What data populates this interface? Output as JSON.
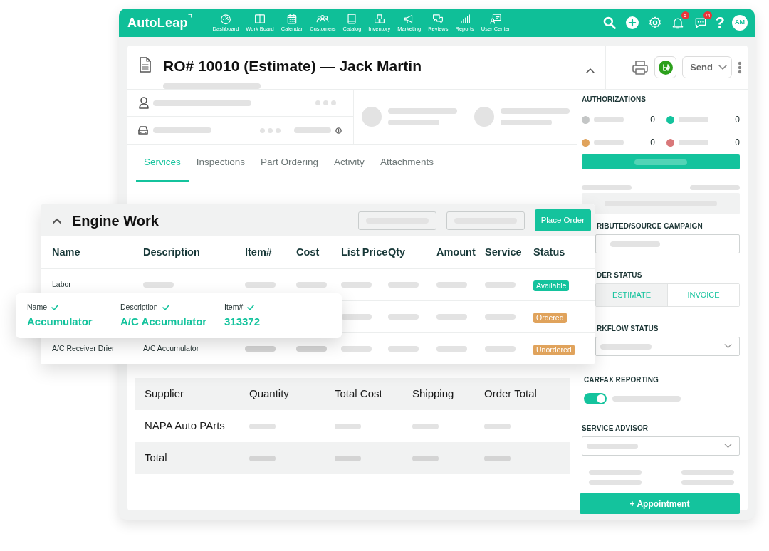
{
  "app": {
    "logo": "AutoLeap"
  },
  "nav": [
    {
      "label": "Dashboard"
    },
    {
      "label": "Work Board"
    },
    {
      "label": "Calendar"
    },
    {
      "label": "Customers"
    },
    {
      "label": "Catalog"
    },
    {
      "label": "Inventory"
    },
    {
      "label": "Marketing"
    },
    {
      "label": "Reviews"
    },
    {
      "label": "Reports"
    },
    {
      "label": "User Center"
    }
  ],
  "nav_tools": {
    "notifications": "5",
    "messages": "74",
    "help": "?",
    "avatar": "AM"
  },
  "repair_order": {
    "title": "RO# 10010 (Estimate) — Jack Martin"
  },
  "actions": {
    "send": "Send"
  },
  "tabs": [
    {
      "label": "Services",
      "selected": true
    },
    {
      "label": "Inspections",
      "selected": false
    },
    {
      "label": "Part Ordering",
      "selected": false
    },
    {
      "label": "Activity",
      "selected": false
    },
    {
      "label": "Attachments",
      "selected": false
    }
  ],
  "engine_work": {
    "title": "Engine Work",
    "place_order": "Place Order",
    "columns": [
      "Name",
      "Description",
      "Item#",
      "Cost",
      "List Price",
      "Qty",
      "Amount",
      "Service",
      "Status"
    ],
    "rows": [
      {
        "name": "Labor",
        "status": "Available",
        "color": "#14c39d"
      },
      {
        "status": "Ordered",
        "color": "#e0a35c"
      },
      {
        "name": "A/C Receiver Drier",
        "description": "A/C Accumulator",
        "status": "Unordered",
        "color": "#e0a35c"
      }
    ]
  },
  "match_popup": {
    "fields": [
      {
        "label": "Name",
        "value": "Accumulator"
      },
      {
        "label": "Description",
        "value": "A/C Accumulator"
      },
      {
        "label": "Item#",
        "value": "313372"
      }
    ]
  },
  "order_summary": {
    "columns": [
      "Supplier",
      "Quantity",
      "Total Cost",
      "Shipping",
      "Order Total"
    ],
    "rows": [
      {
        "kind": "supplier",
        "supplier": "NAPA Auto PArts"
      },
      {
        "kind": "total",
        "supplier": "Total"
      }
    ]
  },
  "sidebar": {
    "authorizations": {
      "title": "AUTHORIZATIONS",
      "items": [
        {
          "color": "#c4c6c6",
          "count": "0"
        },
        {
          "color": "#14c39d",
          "count": "0"
        },
        {
          "color": "#e0a35c",
          "count": "0"
        },
        {
          "color": "#d9787a",
          "count": "0"
        }
      ]
    },
    "campaign_label": "RIBUTED/SOURCE CAMPAIGN",
    "order_status": {
      "label": "DER STATUS",
      "options": [
        {
          "label": "ESTIMATE",
          "selected": true
        },
        {
          "label": "INVOICE",
          "selected": false
        }
      ]
    },
    "workflow_label": "RKFLOW STATUS",
    "carfax": {
      "label": "CARFAX REPORTING",
      "on": true
    },
    "service_advisor_label": "SERVICE ADVISOR",
    "appointment": "+ Appointment"
  }
}
